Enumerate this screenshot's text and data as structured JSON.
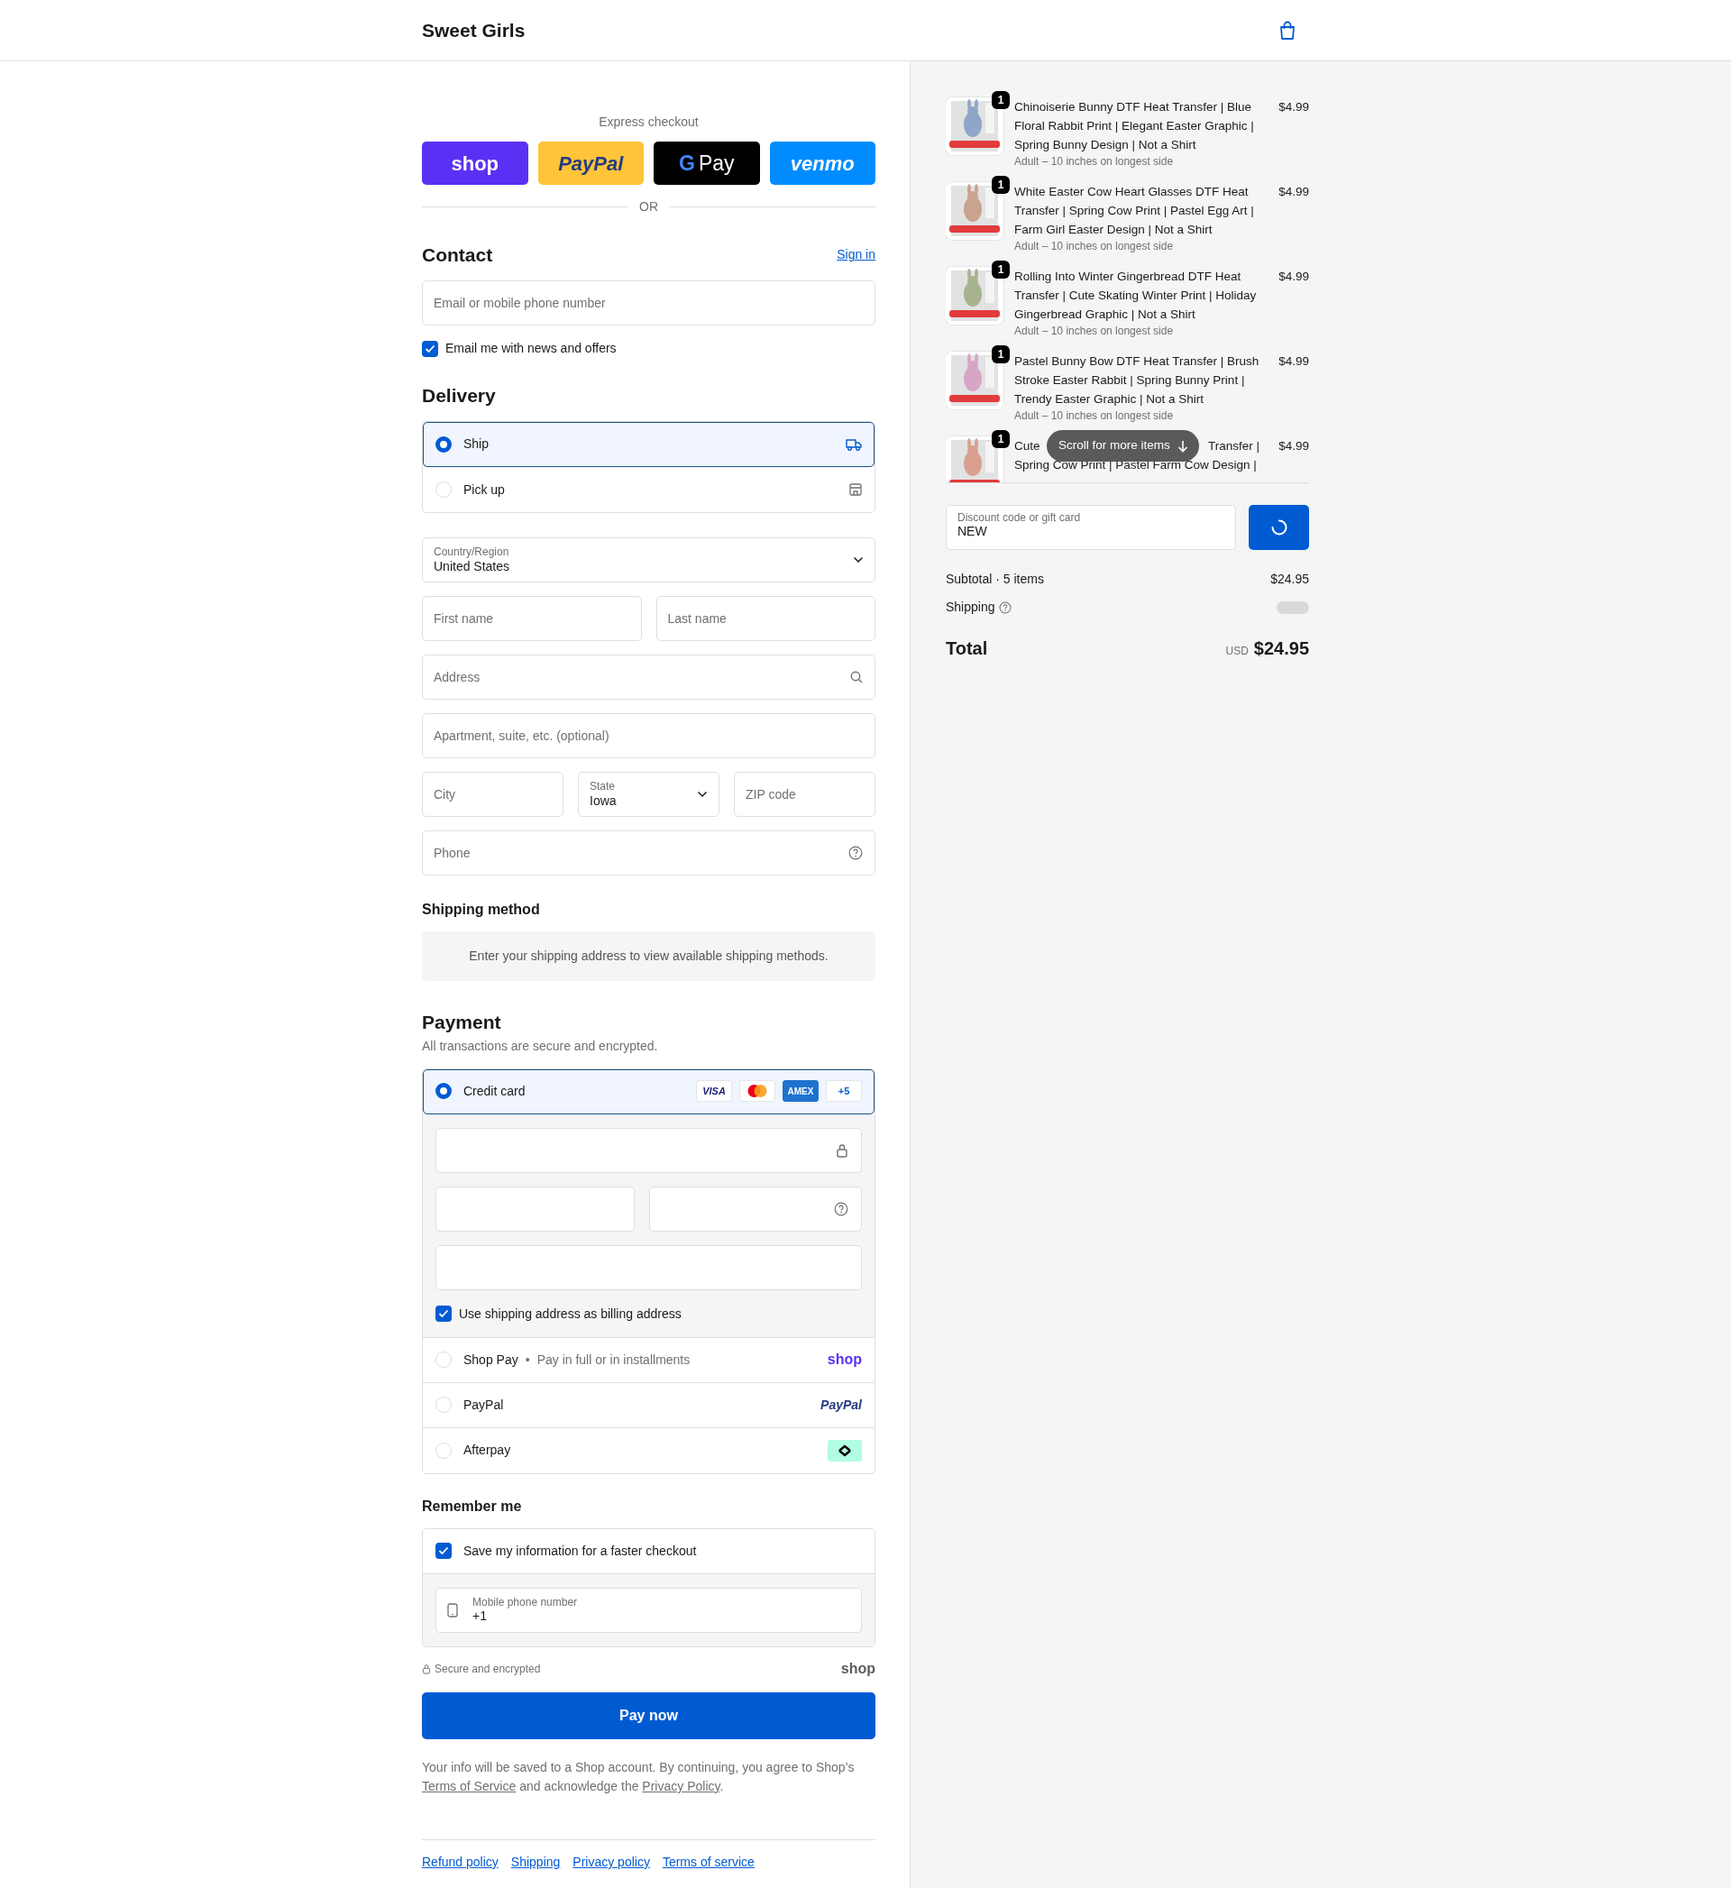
{
  "header": {
    "store_name": "Sweet Girls"
  },
  "express": {
    "label": "Express checkout",
    "divider": "OR",
    "buttons": [
      {
        "kind": "shop",
        "label": "shop"
      },
      {
        "kind": "paypal",
        "label": "PayPal"
      },
      {
        "kind": "gpay",
        "mark": "G",
        "label": "Pay"
      },
      {
        "kind": "venmo",
        "label": "venmo"
      }
    ]
  },
  "contact": {
    "title": "Contact",
    "sign_in": "Sign in",
    "email": {
      "placeholder": "Email or mobile phone number"
    },
    "news": {
      "label": "Email me with news and offers",
      "checked": true
    }
  },
  "delivery": {
    "title": "Delivery",
    "options": [
      {
        "kind": "ship",
        "label": "Ship",
        "selected": true
      },
      {
        "kind": "pickup",
        "label": "Pick up",
        "selected": false
      }
    ],
    "country": {
      "label": "Country/Region",
      "value": "United States"
    },
    "first_name": {
      "placeholder": "First name"
    },
    "last_name": {
      "placeholder": "Last name"
    },
    "address": {
      "placeholder": "Address"
    },
    "apartment": {
      "placeholder": "Apartment, suite, etc. (optional)"
    },
    "city": {
      "placeholder": "City"
    },
    "state": {
      "label": "State",
      "value": "Iowa"
    },
    "zip": {
      "placeholder": "ZIP code"
    },
    "phone": {
      "placeholder": "Phone"
    }
  },
  "shipping_method": {
    "title": "Shipping method",
    "message": "Enter your shipping address to view available shipping methods."
  },
  "payment": {
    "title": "Payment",
    "subtitle": "All transactions are secure and encrypted.",
    "methods": [
      {
        "kind": "card",
        "label": "Credit card",
        "selected": true,
        "badges": [
          {
            "kind": "visa",
            "text": "VISA"
          },
          {
            "kind": "mastercard"
          },
          {
            "kind": "amex",
            "text": "AMEX"
          },
          {
            "kind": "more",
            "text": "+5"
          }
        ]
      },
      {
        "kind": "shoppay",
        "label": "Shop Pay",
        "separator": "•",
        "note": "Pay in full or in installments",
        "logo": "shop",
        "selected": false
      },
      {
        "kind": "paypal",
        "label": "PayPal",
        "logo": "PayPal",
        "selected": false
      },
      {
        "kind": "afterpay",
        "label": "Afterpay",
        "selected": false
      }
    ],
    "billing_same": {
      "label": "Use shipping address as billing address",
      "checked": true
    }
  },
  "remember": {
    "title": "Remember me",
    "save": {
      "label": "Save my information for a faster checkout",
      "checked": true
    },
    "mobile": {
      "label": "Mobile phone number",
      "value": "+1"
    }
  },
  "secure": {
    "text": "Secure and encrypted",
    "logo": "shop"
  },
  "pay_button": "Pay now",
  "legal": [
    {
      "kind": "text",
      "text": "Your info will be saved to a Shop account. By continuing, you agree to Shop’s "
    },
    {
      "kind": "link",
      "text": "Terms of Service"
    },
    {
      "kind": "text",
      "text": " and acknowledge the "
    },
    {
      "kind": "link",
      "text": "Privacy Policy"
    },
    {
      "kind": "text",
      "text": "."
    }
  ],
  "footer_links": [
    "Refund policy",
    "Shipping",
    "Privacy policy",
    "Terms of service"
  ],
  "summary": {
    "items": [
      {
        "title": "Chinoiserie Bunny DTF Heat Transfer | Blue Floral Rabbit Print | Elegant Easter Graphic | Spring Bunny Design | Not a Shirt",
        "variant": "Adult – 10 inches on longest side",
        "price": "$4.99",
        "quantity": "1"
      },
      {
        "title": "White Easter Cow Heart Glasses DTF Heat Transfer | Spring Cow Print | Pastel Egg Art | Farm Girl Easter Design | Not a Shirt",
        "variant": "Adult – 10 inches on longest side",
        "price": "$4.99",
        "quantity": "1"
      },
      {
        "title": "Rolling Into Winter Gingerbread DTF Heat Transfer | Cute Skating Winter Print | Holiday Gingerbread Graphic | Not a Shirt",
        "variant": "Adult – 10 inches on longest side",
        "price": "$4.99",
        "quantity": "1"
      },
      {
        "title": "Pastel Bunny Bow DTF Heat Transfer | Brush Stroke Easter Rabbit | Spring Bunny Print | Trendy Easter Graphic | Not a Shirt",
        "variant": "Adult – 10 inches on longest side",
        "price": "$4.99",
        "quantity": "1"
      },
      {
        "title_parts": [
          "Cute",
          "Transfer |",
          "Spring Cow Print | Pastel Farm Cow Design |"
        ],
        "price": "$4.99",
        "quantity": "1"
      }
    ],
    "scroll_hint": "Scroll for more items",
    "discount": {
      "label": "Discount code or gift card",
      "value": "NEW"
    },
    "subtotal": {
      "label": "Subtotal · 5 items",
      "value": "$24.95"
    },
    "shipping": {
      "label": "Shipping"
    },
    "total": {
      "label": "Total",
      "currency": "USD",
      "value": "$24.95"
    }
  }
}
